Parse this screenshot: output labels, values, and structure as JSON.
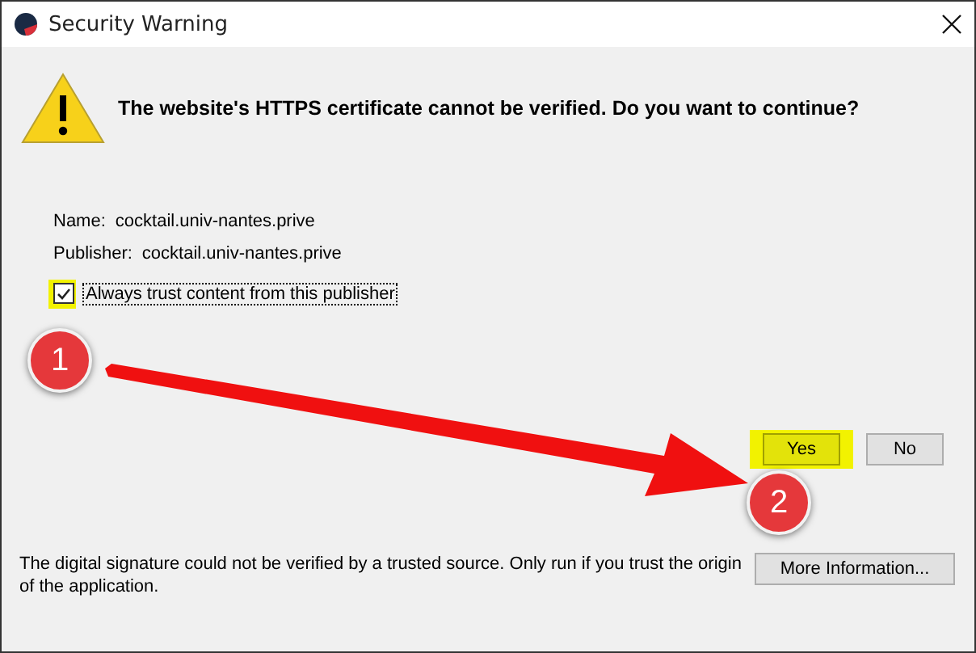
{
  "window": {
    "title": "Security Warning"
  },
  "headline": "The website's HTTPS certificate cannot be verified. Do you want to continue?",
  "details": [
    {
      "label": "Name:",
      "value": "cocktail.univ-nantes.prive"
    },
    {
      "label": "Publisher:",
      "value": "cocktail.univ-nantes.prive"
    }
  ],
  "trust_checkbox": {
    "label": "Always trust content from this publisher",
    "checked": true
  },
  "buttons": [
    {
      "label": "Yes",
      "highlighted": true
    },
    {
      "label": "No",
      "highlighted": false
    }
  ],
  "footer": {
    "text": "The digital signature could not be verified by a trusted source. Only run if you trust the origin of the application.",
    "button": "More Information..."
  },
  "annotations": [
    {
      "label": "1"
    },
    {
      "label": "2"
    }
  ]
}
